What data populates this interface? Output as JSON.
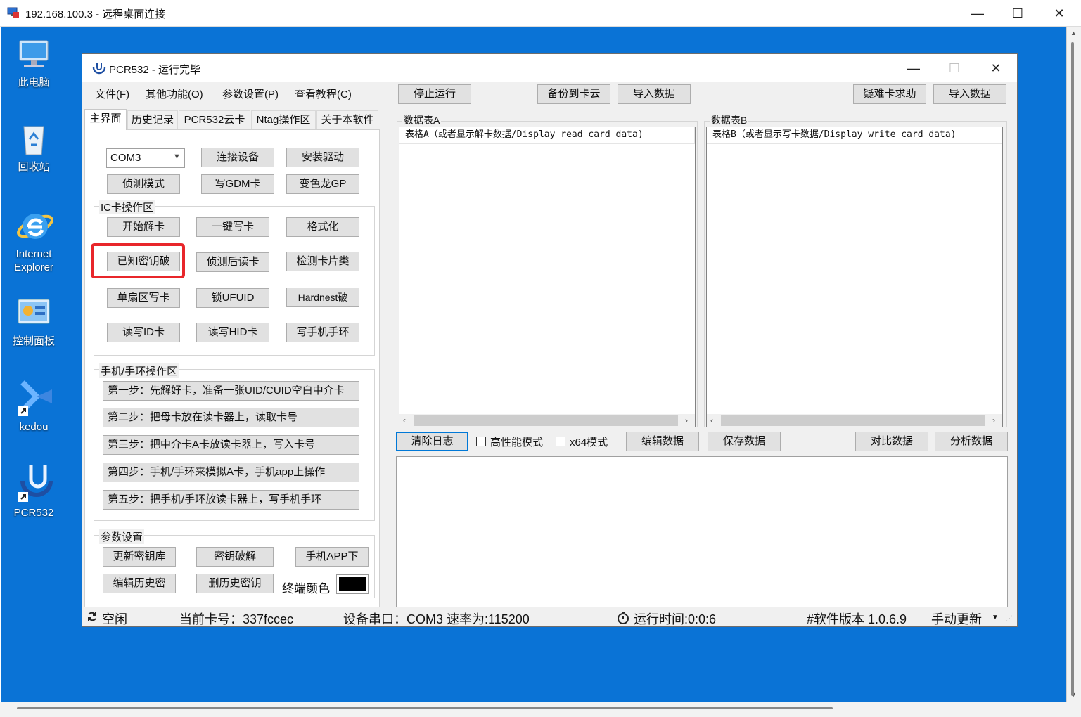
{
  "rdp": {
    "title": "192.168.100.3 - 远程桌面连接",
    "minimize": "—",
    "maximize": "☐",
    "close": "✕"
  },
  "desktop": {
    "icons": [
      {
        "label": "此电脑",
        "icon": "computer-icon"
      },
      {
        "label": "回收站",
        "icon": "recycle-bin-icon"
      },
      {
        "label": "Internet Explorer",
        "icon": "internet-explorer-icon"
      },
      {
        "label": "控制面板",
        "icon": "control-panel-icon"
      },
      {
        "label": "kedou",
        "icon": "kedou-icon"
      },
      {
        "label": "PCR532",
        "icon": "pcr532-icon"
      }
    ]
  },
  "app": {
    "title": "PCR532 - 运行完毕",
    "minimize": "—",
    "maximize": "☐",
    "close": "✕",
    "menu": [
      "文件(F)",
      "其他功能(O)",
      "参数设置(P)",
      "查看教程(C)"
    ],
    "toolbar": {
      "stop": "停止运行",
      "backup": "备份到卡云",
      "import1": "导入数据",
      "help": "疑难卡求助",
      "import2": "导入数据"
    },
    "tabs": [
      "主界面",
      "历史记录",
      "PCR532云卡",
      "Ntag操作区",
      "关于本软件"
    ],
    "device": {
      "port": "COM3",
      "connect": "连接设备",
      "install": "安装驱动",
      "detect": "侦测模式",
      "write_gdm": "写GDM卡",
      "gp": "变色龙GP"
    },
    "ic_group": {
      "label": "IC卡操作区",
      "buttons": [
        "开始解卡",
        "一键写卡",
        "格式化",
        "已知密钥破",
        "侦测后读卡",
        "检测卡片类",
        "单扇区写卡",
        "锁UFUID",
        "Hardnest破",
        "读写ID卡",
        "读写HID卡",
        "写手机手环"
      ]
    },
    "phone_group": {
      "label": "手机/手环操作区",
      "steps": [
        "第一步：先解好卡，准备一张UID/CUID空白中介卡",
        "第二步：把母卡放在读卡器上，读取卡号",
        "第三步：把中介卡A卡放读卡器上，写入卡号",
        "第四步：手机/手环来模拟A卡，手机app上操作",
        "第五步：把手机/手环放读卡器上，写手机手环"
      ]
    },
    "params_group": {
      "label": "参数设置",
      "update_keys": "更新密钥库",
      "key_crack": "密钥破解",
      "phone_app": "手机APP下",
      "edit_history": "编辑历史密",
      "delete_history": "删历史密钥",
      "terminal_color_label": "终端颜色",
      "terminal_color": "#000000"
    },
    "table_a": {
      "group_label": "数据表A",
      "header": "表格A（或者显示解卡数据/Display read card data)"
    },
    "table_b": {
      "group_label": "数据表B",
      "header": "表格B（或者显示写卡数据/Display write card data)"
    },
    "actions": {
      "clear_log": "清除日志",
      "high_perf": "高性能模式",
      "x64": "x64模式",
      "edit_data": "编辑数据",
      "save_data": "保存数据",
      "compare": "对比数据",
      "analyze": "分析数据"
    },
    "status": {
      "state": "空闲",
      "card": "当前卡号：337fccec",
      "serial": "设备串口：COM3 速率为:115200",
      "runtime": "运行时间:0:0:6",
      "version": "#软件版本 1.0.6.9",
      "update": "手动更新"
    },
    "highlight_color": "#e8262a"
  }
}
